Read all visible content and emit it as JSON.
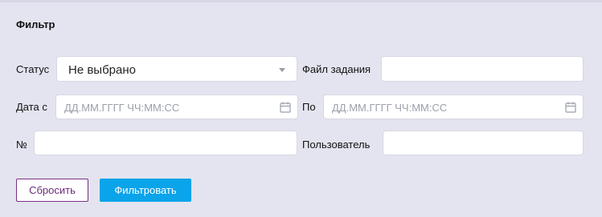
{
  "filter": {
    "title": "Фильтр",
    "status": {
      "label": "Статус",
      "value": "Не выбрано"
    },
    "task_file": {
      "label": "Файл задания",
      "value": ""
    },
    "date_from": {
      "label": "Дата с",
      "placeholder": "ДД.ММ.ГГГГ ЧЧ:ММ:СС"
    },
    "date_to": {
      "label": "По",
      "placeholder": "ДД.ММ.ГГГГ ЧЧ:ММ:СС"
    },
    "number": {
      "label": "№",
      "value": ""
    },
    "user": {
      "label": "Пользователь",
      "value": ""
    },
    "reset_label": "Сбросить",
    "apply_label": "Фильтровать"
  },
  "colors": {
    "background": "#e3e4ef",
    "reset_border": "#7a2e86",
    "apply_bg": "#0aa4ea"
  }
}
